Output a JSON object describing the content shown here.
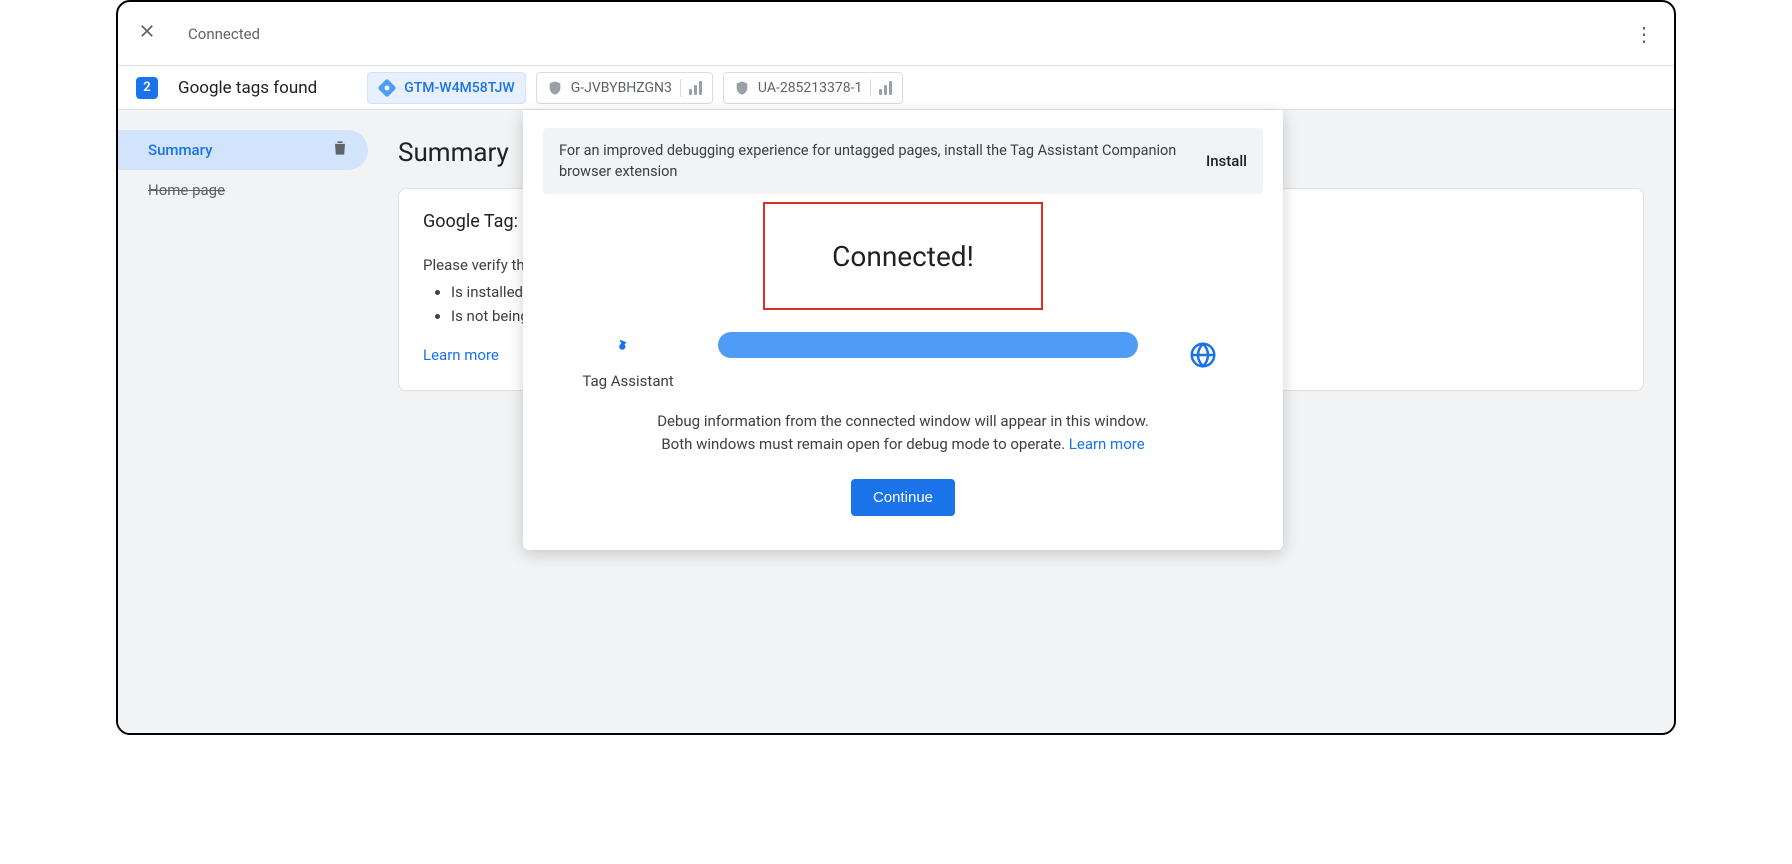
{
  "top": {
    "status": "Connected"
  },
  "strip": {
    "count": "2",
    "label": "Google tags found",
    "tabs": [
      {
        "id": "GTM-W4M58TJW",
        "active": true
      },
      {
        "id": "G-JVBYBHZGN3",
        "active": false
      },
      {
        "id": "UA-285213378-1",
        "active": false
      }
    ]
  },
  "sidebar": {
    "items": [
      {
        "label": "Summary",
        "active": true
      },
      {
        "label": "Home page",
        "strike": true
      }
    ]
  },
  "summary": {
    "heading": "Summary",
    "card": {
      "title_prefix": "Google Tag: GTM",
      "verify": "Please verify that t",
      "bullets": [
        "Is installed on",
        "Is not being blo"
      ],
      "learn": "Learn more"
    }
  },
  "modal": {
    "banner_text": "For an improved debugging experience for untagged pages, install the Tag Assistant Companion browser extension",
    "banner_action": "Install",
    "connected": "Connected!",
    "ta_label": "Tag Assistant",
    "info1": "Debug information from the connected window will appear in this window.",
    "info2_prefix": "Both windows must remain open for debug mode to operate. ",
    "info2_link": "Learn more",
    "continue": "Continue"
  }
}
